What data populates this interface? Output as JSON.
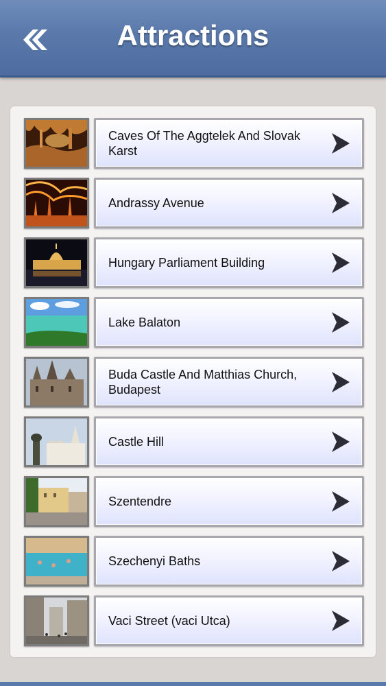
{
  "header": {
    "title": "Attractions",
    "back_icon": "double-chevron-left-icon"
  },
  "colors": {
    "header_bg": "#5a79ab",
    "panel_bg": "#f4f3f2",
    "page_bg": "#d9d5d3",
    "button_bg": "#eef0ff",
    "chevron": "#2c2c36"
  },
  "attractions": [
    {
      "label": "Caves Of The Aggtelek And Slovak Karst",
      "thumb": "cave"
    },
    {
      "label": "Andrassy Avenue",
      "thumb": "avenue-lights"
    },
    {
      "label": "Hungary Parliament Building",
      "thumb": "parliament-night"
    },
    {
      "label": "Lake Balaton",
      "thumb": "lake"
    },
    {
      "label": "Buda Castle And Matthias Church, Budapest",
      "thumb": "church"
    },
    {
      "label": "Castle Hill",
      "thumb": "castle-hill"
    },
    {
      "label": "Szentendre",
      "thumb": "town-street"
    },
    {
      "label": "Szechenyi Baths",
      "thumb": "thermal-bath"
    },
    {
      "label": "Vaci Street (vaci Utca)",
      "thumb": "shopping-street"
    }
  ]
}
